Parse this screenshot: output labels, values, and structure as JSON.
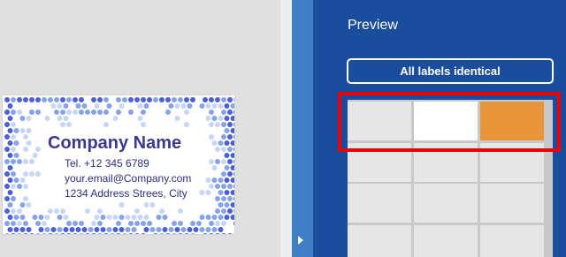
{
  "business_card": {
    "company_name": "Company Name",
    "tel": "Tel. +12 345 6789",
    "email": "your.email@Company.com",
    "address": "1234 Address Strees, City"
  },
  "preview_panel": {
    "title": "Preview",
    "all_labels_button": "All labels identical",
    "label_cells": [
      {
        "row": 0,
        "col": 0,
        "fill": "#e6e6e6"
      },
      {
        "row": 0,
        "col": 1,
        "fill": "#ffffff"
      },
      {
        "row": 0,
        "col": 2,
        "fill": "#e8953a"
      },
      {
        "row": 1,
        "col": 0,
        "fill": "#e6e6e6"
      },
      {
        "row": 1,
        "col": 1,
        "fill": "#e6e6e6"
      },
      {
        "row": 1,
        "col": 2,
        "fill": "#e6e6e6"
      },
      {
        "row": 2,
        "col": 0,
        "fill": "#e6e6e6"
      },
      {
        "row": 2,
        "col": 1,
        "fill": "#e6e6e6"
      },
      {
        "row": 2,
        "col": 2,
        "fill": "#e6e6e6"
      },
      {
        "row": 3,
        "col": 0,
        "fill": "#e6e6e6"
      },
      {
        "row": 3,
        "col": 1,
        "fill": "#e6e6e6"
      },
      {
        "row": 3,
        "col": 2,
        "fill": "#e6e6e6"
      }
    ]
  },
  "colors": {
    "panel_blue": "#1a4e9c",
    "panel_strip": "#3f7dc5",
    "highlight_red": "#ee0000",
    "selected_orange": "#e8953a",
    "company_text": "#3b3a8f",
    "dot_dark": "#4d5fd6",
    "dot_mid": "#86a3e8",
    "dot_light": "#c7d6f5"
  }
}
